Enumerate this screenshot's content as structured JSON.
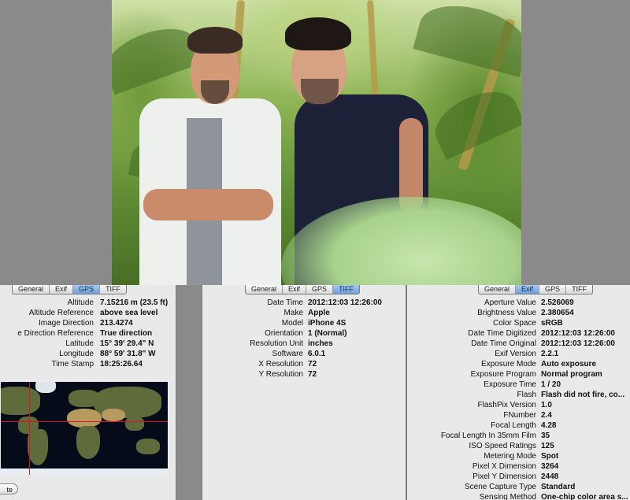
{
  "tabs_gps_panel": [
    "General",
    "Exif",
    "GPS",
    "TIFF"
  ],
  "tabs_tiff_panel": [
    "General",
    "Exif",
    "GPS",
    "TIFF"
  ],
  "tabs_exif_panel": [
    "General",
    "Exif",
    "GPS",
    "TIFF"
  ],
  "gps": {
    "active_tab": "GPS",
    "rows": [
      {
        "label": "Altitude",
        "value": "7.15216 m (23.5 ft)"
      },
      {
        "label": "Altitude Reference",
        "value": "above sea level"
      },
      {
        "label": "Image Direction",
        "value": "213.4274"
      },
      {
        "label": "e Direction Reference",
        "value": "True direction"
      },
      {
        "label": "Latitude",
        "value": "15° 39' 29.4\" N"
      },
      {
        "label": "Longitude",
        "value": "88° 59' 31.8\" W"
      },
      {
        "label": "Time Stamp",
        "value": "18:25:26.64"
      }
    ],
    "button_label": "te"
  },
  "tiff": {
    "active_tab": "TIFF",
    "rows": [
      {
        "label": "Date Time",
        "value": "2012:12:03 12:26:00"
      },
      {
        "label": "Make",
        "value": "Apple"
      },
      {
        "label": "Model",
        "value": "iPhone 4S"
      },
      {
        "label": "Orientation",
        "value": "1 (Normal)"
      },
      {
        "label": "Resolution Unit",
        "value": "inches"
      },
      {
        "label": "Software",
        "value": "6.0.1"
      },
      {
        "label": "X Resolution",
        "value": "72"
      },
      {
        "label": "Y Resolution",
        "value": "72"
      }
    ]
  },
  "exif": {
    "active_tab": "Exif",
    "rows": [
      {
        "label": "Aperture Value",
        "value": "2.526069"
      },
      {
        "label": "Brightness Value",
        "value": "2.380654"
      },
      {
        "label": "Color Space",
        "value": "sRGB"
      },
      {
        "label": "Date Time Digitized",
        "value": "2012:12:03 12:26:00"
      },
      {
        "label": "Date Time Original",
        "value": "2012:12:03 12:26:00"
      },
      {
        "label": "Exif Version",
        "value": "2.2.1"
      },
      {
        "label": "Exposure Mode",
        "value": "Auto exposure"
      },
      {
        "label": "Exposure Program",
        "value": "Normal program"
      },
      {
        "label": "Exposure Time",
        "value": "1 / 20"
      },
      {
        "label": "Flash",
        "value": "Flash did not fire, co..."
      },
      {
        "label": "FlashPix Version",
        "value": "1.0"
      },
      {
        "label": "FNumber",
        "value": "2.4"
      },
      {
        "label": "Focal Length",
        "value": "4.28"
      },
      {
        "label": "Focal Length In 35mm Film",
        "value": "35"
      },
      {
        "label": "ISO Speed Ratings",
        "value": "125"
      },
      {
        "label": "Metering Mode",
        "value": "Spot"
      },
      {
        "label": "Pixel X Dimension",
        "value": "3264"
      },
      {
        "label": "Pixel Y Dimension",
        "value": "2448"
      },
      {
        "label": "Scene Capture Type",
        "value": "Standard"
      },
      {
        "label": "Sensing Method",
        "value": "One-chip color area s..."
      }
    ]
  },
  "colors": {
    "active_tab": "#6e9fd8",
    "panel_bg": "#e9e9e9",
    "crosshair": "#e0102a"
  }
}
